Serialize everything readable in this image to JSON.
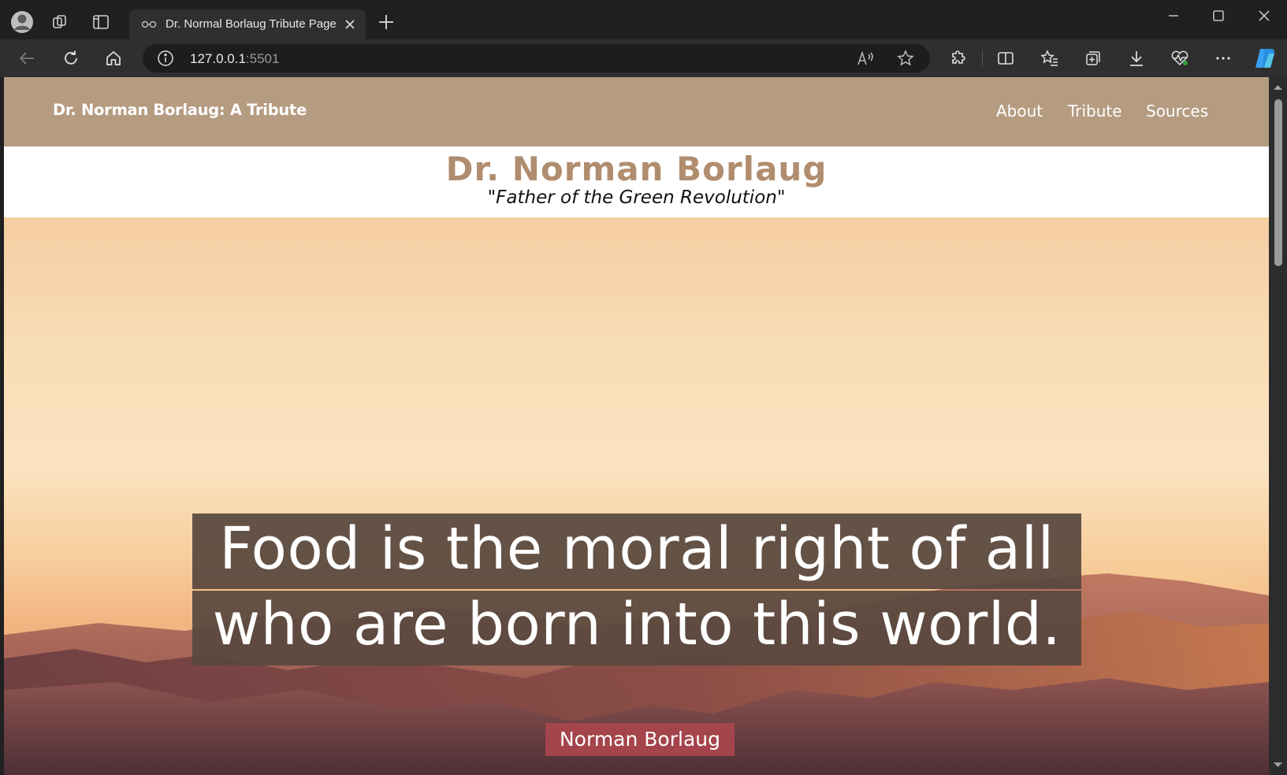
{
  "browser": {
    "tab_title": "Dr. Normal Borlaug Tribute Page",
    "address_host": "127.0.0.1",
    "address_port": ":5501"
  },
  "page": {
    "brand": "Dr. Norman Borlaug: A Tribute",
    "nav": [
      "About",
      "Tribute",
      "Sources"
    ],
    "title": "Dr. Norman Borlaug",
    "subtitle": "\"Father of the Green Revolution\"",
    "quote_lines": [
      "Food is the moral right of all",
      "who are born into this world."
    ],
    "quote_author": "Norman Borlaug"
  },
  "colors": {
    "nav_bg": "#b59b80",
    "title_color": "#b08d6e",
    "author_badge": "#a4444b",
    "quote_box": "#58483e"
  },
  "icons": {
    "titlebar": [
      "profile-icon",
      "workspaces-icon",
      "vertical-tabs-icon",
      "new-tab-icon"
    ],
    "toolbar": [
      "back-icon",
      "refresh-icon",
      "home-icon",
      "site-info-icon",
      "read-aloud-icon",
      "favorite-star-icon",
      "extensions-icon",
      "split-screen-icon",
      "favorites-icon",
      "collections-icon",
      "downloads-icon",
      "browser-essentials-icon",
      "more-icon",
      "copilot-icon"
    ]
  }
}
